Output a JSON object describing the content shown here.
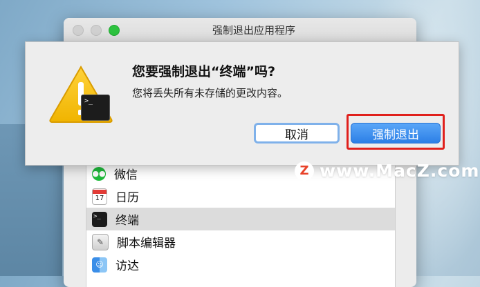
{
  "window": {
    "title": "强制退出应用程序"
  },
  "alert": {
    "heading": "您要强制退出“终端”吗?",
    "message": "您将丢失所有未存储的更改内容。",
    "cancel_label": "取消",
    "force_quit_label": "强制退出",
    "terminal_badge_text": ">_"
  },
  "apps": [
    {
      "label": "微信",
      "icon": "wechat-icon",
      "selected": false
    },
    {
      "label": "日历",
      "icon": "calendar-icon",
      "selected": false,
      "calendar_day": "17"
    },
    {
      "label": "终端",
      "icon": "terminal-icon",
      "selected": true
    },
    {
      "label": "脚本编辑器",
      "icon": "script-editor-icon",
      "selected": false
    },
    {
      "label": "访达",
      "icon": "finder-icon",
      "selected": false
    }
  ],
  "watermark": {
    "text": "www.MacZ.com",
    "logo": "Z"
  },
  "colors": {
    "highlight_red": "#e0201c",
    "primary_blue": "#2c7fe6",
    "zoom_green": "#2dc23f"
  }
}
